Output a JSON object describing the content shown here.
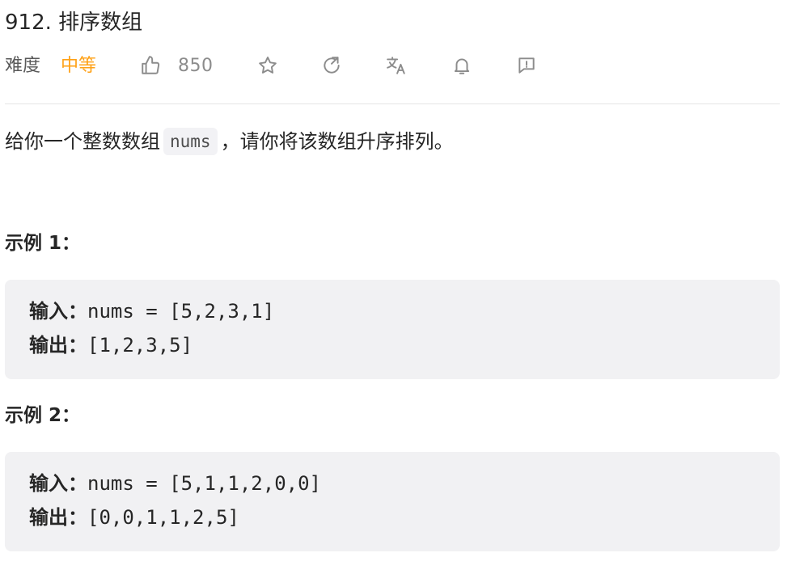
{
  "problem": {
    "title": "912. 排序数组",
    "difficulty_label": "难度",
    "difficulty": "中等",
    "likes": "850"
  },
  "toolbar": {
    "icons": [
      "thumbs-up-icon",
      "star-icon",
      "share-icon",
      "translate-icon",
      "bell-icon",
      "feedback-icon"
    ]
  },
  "description": {
    "before": "给你一个整数数组",
    "code": "nums",
    "after": "，请你将该数组升序排列。"
  },
  "examples": [
    {
      "title": "示例 1：",
      "input_label": "输入：",
      "input_value": "nums = [5,2,3,1]",
      "output_label": "输出：",
      "output_value": "[1,2,3,5]"
    },
    {
      "title": "示例 2：",
      "input_label": "输入：",
      "input_value": "nums = [5,1,1,2,0,0]",
      "output_label": "输出：",
      "output_value": "[0,0,1,1,2,5]"
    }
  ],
  "colors": {
    "difficulty_medium": "#ffa116",
    "icon_gray": "#8c8c8c",
    "code_block_bg": "#f1f1f3"
  }
}
